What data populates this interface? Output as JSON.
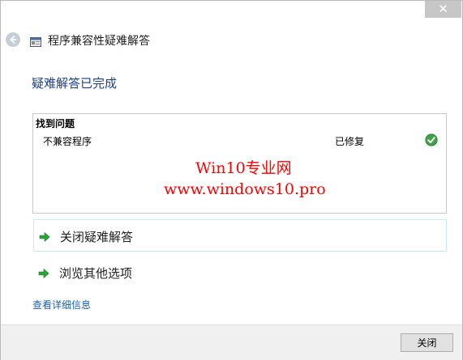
{
  "window": {
    "close_glyph": "✕"
  },
  "nav": {
    "back_icon": "back-arrow-icon",
    "app_icon": "troubleshooter-icon",
    "title": "程序兼容性疑难解答"
  },
  "main": {
    "heading": "疑难解答已完成",
    "problems": {
      "header": "找到问题",
      "items": [
        {
          "name": "不兼容程序",
          "status": "已修复",
          "status_icon": "check-icon"
        }
      ]
    },
    "watermark": {
      "line1": "Win10专业网",
      "line2": "www.windows10.pro"
    },
    "commands": [
      {
        "label": "关闭疑难解答",
        "icon": "green-arrow-icon"
      },
      {
        "label": "浏览其他选项",
        "icon": "green-arrow-icon"
      }
    ],
    "details_link": "查看详细信息"
  },
  "footer": {
    "close_label": "关闭"
  },
  "colors": {
    "heading": "#1b3f8a",
    "link": "#1c5fae",
    "watermark": "#ff0000",
    "check": "#3fa14a",
    "arrow": "#2aa33b",
    "selected_border": "#c4ecf5",
    "footer_bg": "#f0f0f0"
  }
}
